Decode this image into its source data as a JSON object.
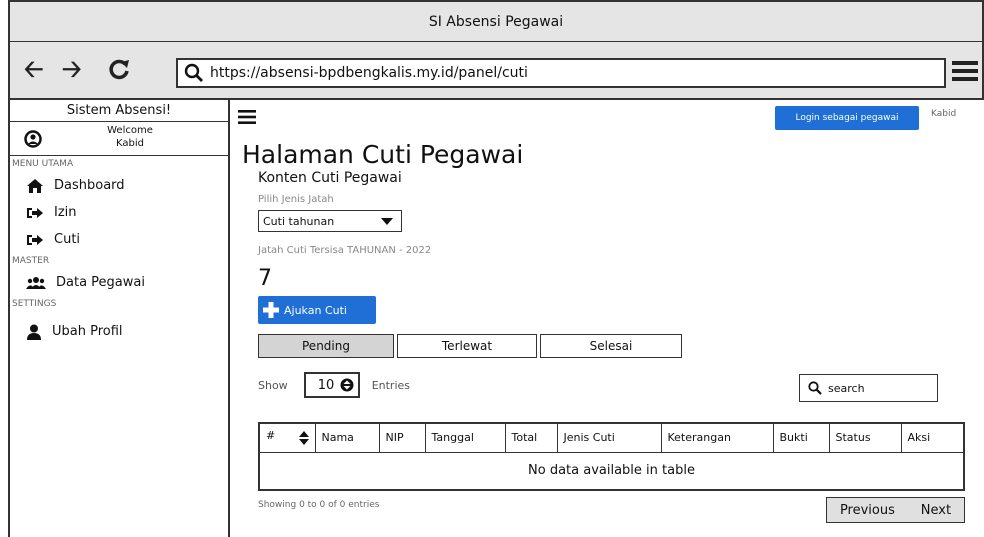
{
  "window": {
    "title": "SI Absensi Pegawai"
  },
  "browser": {
    "url": "https://absensi-bpdbengkalis.my.id/panel/cuti"
  },
  "sidebar": {
    "title": "Sistem Absensi!",
    "welcome_line1": "Welcome",
    "welcome_line2": "Kabid",
    "sections": {
      "menu_utama": "MENU UTAMA",
      "master": "MASTER",
      "settings": "SETTINGS"
    },
    "items": {
      "dashboard": "Dashboard",
      "izin": "Izin",
      "cuti": "Cuti",
      "data_pegawai": "Data Pegawai",
      "ubah_profil": "Ubah Profil"
    }
  },
  "header": {
    "login_button": "Login sebagai pegawai",
    "role": "Kabid"
  },
  "main": {
    "title": "Halaman Cuti Pegawai",
    "subtitle": "Konten Cuti Pegawai",
    "select_label": "Pilih Jenis Jatah",
    "select_value": "Cuti tahunan",
    "quota_label": "Jatah Cuti Tersisa TAHUNAN - 2022",
    "quota_value": "7",
    "submit_button": "Ajukan Cuti",
    "tabs": [
      "Pending",
      "Terlewat",
      "Selesai"
    ],
    "show_label": "Show",
    "entries_value": "10",
    "entries_label": "Entries",
    "search_placeholder": "search",
    "table": {
      "columns": [
        "#",
        "Nama",
        "NIP",
        "Tanggal",
        "Total",
        "Jenis Cuti",
        "Keterangan",
        "Bukti",
        "Status",
        "Aksi"
      ],
      "empty_message": "No data available in table"
    },
    "showing_info": "Showing 0 to 0 of 0 entries",
    "pager": {
      "previous": "Previous",
      "next": "Next"
    }
  },
  "colors": {
    "primary": "#1f6fd6",
    "chrome": "#e5e5e5"
  }
}
